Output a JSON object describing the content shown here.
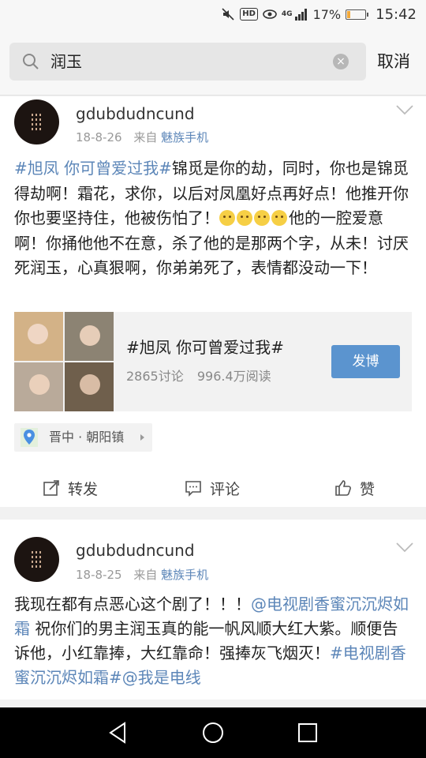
{
  "status_bar": {
    "hd_label": "HD",
    "network": "4G",
    "battery": "17%",
    "battery_level": 0.17,
    "time": "15:42"
  },
  "search": {
    "query": "润玉",
    "cancel_label": "取消"
  },
  "post1": {
    "username": "gdubdudncund",
    "date": "18-8-26",
    "from_prefix": "来自",
    "source": "魅族手机",
    "text_parts": {
      "hashtag": "#旭凤 你可曾爱过我#",
      "body1": "锦觅是你的劫，同时，你也是锦觅得劫啊！霜花，求你，以后对凤凰好点再好点！他推开你你也要坚持住，他被伤怕了！",
      "body2": "他的一腔爱意啊！你捅他他不在意，杀了他的是那两个字，从未！讨厌死润玉，心真狠啊，你弟弟死了，表情都没动一下！"
    },
    "topic_card": {
      "title": "#旭凤 你可曾爱过我#",
      "discussions": "2865讨论",
      "reads": "996.4万阅读",
      "button_label": "发博"
    },
    "location": "晋中 · 朝阳镇",
    "actions": {
      "repost": "转发",
      "comment": "评论",
      "like": "赞"
    }
  },
  "post2": {
    "username": "gdubdudncund",
    "date": "18-8-25",
    "from_prefix": "来自",
    "source": "魅族手机",
    "text_parts": {
      "body1": "我现在都有点恶心这个剧了！！！",
      "mention1": "@电视剧香蜜沉沉烬如霜",
      "body2": " 祝你们的男主润玉真的能一帆风顺大红大紫。顺便告诉他，小红靠捧，大红靠命！强捧灰飞烟灭！",
      "hashtag": "#电视剧香蜜沉沉烬如霜#",
      "mention2": "@我是电线"
    }
  },
  "colors": {
    "link": "#5c86b8",
    "button": "#5b94cf",
    "battery_fill": "#f2a93b"
  }
}
